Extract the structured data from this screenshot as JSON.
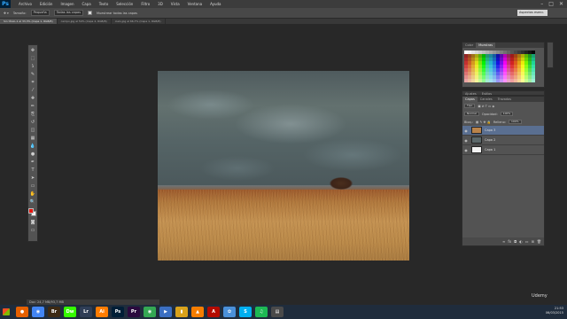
{
  "app": {
    "logo": "Ps"
  },
  "menu": [
    "Archivo",
    "Edición",
    "Imagen",
    "Capa",
    "Texto",
    "Selección",
    "Filtro",
    "3D",
    "Vista",
    "Ventana",
    "Ayuda"
  ],
  "window_controls": [
    "–",
    "□",
    "✕"
  ],
  "options_bar": {
    "sample_label": "Todas las capas",
    "size_label": "Tamaño:",
    "size_value": "Pequeña",
    "contiguous_label": "Muestrear todas las capas",
    "workspace": "Aspectos esenc."
  },
  "doc_tabs": [
    {
      "label": "Sin título-1 al 33,3% (Capa 1, RGB/8)",
      "active": true
    },
    {
      "label": "campo.jpg al 50% (Capa 2, RGB/8)",
      "active": false
    },
    {
      "label": "cielo.jpg al 66,7% (Capa 1, RGB/8)",
      "active": false
    }
  ],
  "tools": [
    "move-tool",
    "marquee-tool",
    "lasso-tool",
    "quick-select-tool",
    "crop-tool",
    "eyedropper-tool",
    "healing-tool",
    "brush-tool",
    "clone-tool",
    "history-brush-tool",
    "eraser-tool",
    "gradient-tool",
    "blur-tool",
    "dodge-tool",
    "pen-tool",
    "type-tool",
    "path-select-tool",
    "shape-tool",
    "hand-tool",
    "zoom-tool"
  ],
  "tool_glyphs": [
    "✥",
    "⬚",
    "ʖ",
    "✎",
    "⌗",
    "⁄",
    "✚",
    "✏",
    "⎘",
    "↺",
    "◫",
    "▦",
    "💧",
    "●",
    "✒",
    "T",
    "➤",
    "▭",
    "✋",
    "🔍"
  ],
  "colors": {
    "foreground": "#e6160f",
    "background": "#ffffff"
  },
  "swatches_panel": {
    "tabs": [
      "Color",
      "Muestras"
    ],
    "active_tab": 1
  },
  "adjust_strip": {
    "tabs": [
      "Ajustes",
      "Estilos"
    ]
  },
  "layers_panel": {
    "tabs": [
      "Capas",
      "Canales",
      "Trazados"
    ],
    "kind_filter": "Tipo",
    "blend_mode": "Normal",
    "opacity_label": "Opacidad:",
    "opacity_value": "100%",
    "lock_label": "Bloq.:",
    "fill_label": "Relleno:",
    "fill_value": "100%",
    "layers": [
      {
        "name": "Capa 3",
        "thumb": "#b9834a",
        "selected": true
      },
      {
        "name": "Capa 2",
        "thumb": "#5c686a",
        "selected": false
      },
      {
        "name": "Capa 1",
        "thumb": "#f2f2f2",
        "selected": false
      }
    ],
    "footer_icons": [
      "link-icon",
      "fx-icon",
      "mask-icon",
      "adjustment-icon",
      "group-icon",
      "new-layer-icon",
      "trash-icon"
    ]
  },
  "status": "Doc: 24,7 MB/93,7 MB",
  "watermark": "Udemy",
  "taskbar": {
    "apps": [
      {
        "name": "firefox",
        "color": "#e66000",
        "glyph": "●"
      },
      {
        "name": "chrome",
        "color": "#4285f4",
        "glyph": "◉"
      },
      {
        "name": "bridge",
        "color": "#3d2a14",
        "glyph": "Br"
      },
      {
        "name": "dreamweaver",
        "color": "#35fa00",
        "glyph": "Dw"
      },
      {
        "name": "lightroom",
        "color": "#2f3e56",
        "glyph": "Lr"
      },
      {
        "name": "illustrator",
        "color": "#ff7c00",
        "glyph": "Ai"
      },
      {
        "name": "photoshop",
        "color": "#001e36",
        "glyph": "Ps"
      },
      {
        "name": "premiere",
        "color": "#2a0a3e",
        "glyph": "Pr"
      },
      {
        "name": "chrome-2",
        "color": "#34a853",
        "glyph": "◉"
      },
      {
        "name": "media",
        "color": "#3b6fc2",
        "glyph": "▶"
      },
      {
        "name": "files",
        "color": "#d9a21b",
        "glyph": "▮"
      },
      {
        "name": "vlc",
        "color": "#f57d00",
        "glyph": "▲"
      },
      {
        "name": "acrobat",
        "color": "#b30b00",
        "glyph": "A"
      },
      {
        "name": "photos",
        "color": "#4a90d9",
        "glyph": "✿"
      },
      {
        "name": "skype",
        "color": "#00aff0",
        "glyph": "S"
      },
      {
        "name": "spotify",
        "color": "#1db954",
        "glyph": "♫"
      },
      {
        "name": "explorer",
        "color": "#4a4a4a",
        "glyph": "▤"
      }
    ],
    "time": "21:53",
    "date": "06/03/2015"
  }
}
